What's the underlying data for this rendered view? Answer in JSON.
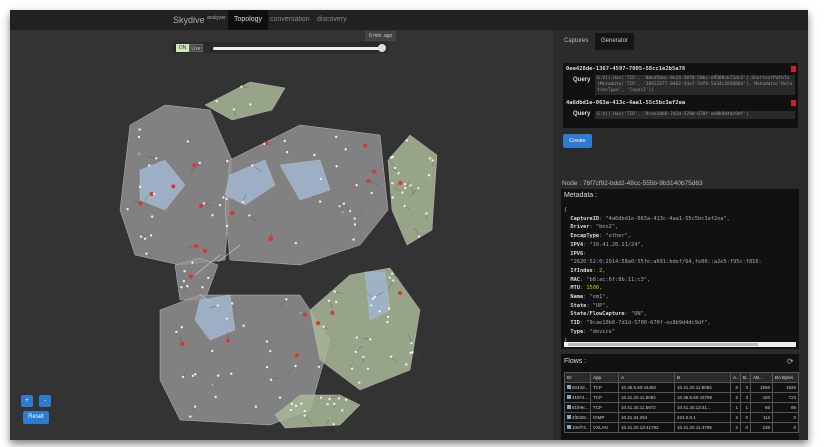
{
  "nav": {
    "brand": "Skydive",
    "brand_sup": "analyzer",
    "tabs": [
      "Topology",
      "conversation",
      "discovery"
    ],
    "active": "Topology"
  },
  "timeline": {
    "on": "ON",
    "live": "Live",
    "ago": "6 min. ago",
    "position": 1.0
  },
  "controls": {
    "zoom_in": "+",
    "zoom_out": "-",
    "reset": "Reset"
  },
  "right": {
    "tabs": [
      "Captures",
      "Generator"
    ],
    "captures": [
      {
        "id": "0ee428de-1367-4597-7005-58cc1e2b5a78",
        "query_label": "Query",
        "query": "G.V().Has('TID', '0dcd50dc-9e24-50f8-58bc-e9508cb71dc2').ShortestPathTo(Metadata('TID', '30922877-0462-54e7-5df0-5d34c2840864'), Metadata('RelationType', 'layer2'))"
      },
      {
        "id": "4a6dbd1e-063a-413c-4aa1-55c5bc3af2ea",
        "query_label": "Query",
        "query": "G.V().Has('TID', '9cae10b8-7d1d-5700-670f-ee8b9d4dc9df')"
      }
    ],
    "create_label": "Create",
    "node_label": "Node : 7bf7cf92-bdd2-48cc-555b-9b3140b75d63",
    "metadata_title": "Metadata :",
    "metadata": [
      [
        "CaptureID",
        "\"4a6dbd1e-063a-413c-4aa1-55c5bc3af2ea\","
      ],
      [
        "Driver",
        "\"bnx2\","
      ],
      [
        "EncapType",
        "\"ether\","
      ],
      [
        "IPV4",
        "\"10.41.20.11/24\","
      ],
      [
        "IPV6",
        ""
      ],
      [
        "",
        "\"2620:52:0:2914:58a0:55fe:a691:bdef/64,fe80::a2e5:f95c:f816:"
      ],
      [
        "IfIndex",
        "2,"
      ],
      [
        "MAC",
        "\"b8:ac:6f:8b:11:c3\","
      ],
      [
        "MTU",
        "1500,"
      ],
      [
        "Name",
        "\"em1\","
      ],
      [
        "State",
        "\"UP\","
      ],
      [
        "State/FlowCapture",
        "\"ON\","
      ],
      [
        "TID",
        "\"9cae10b8-7d1d-5700-670f-ee8b9d4dc9df\","
      ],
      [
        "Type",
        "\"device\""
      ]
    ],
    "flows_title": "Flows :",
    "flows_columns": [
      "ID",
      "App.",
      "A",
      "B",
      "A...",
      "B...",
      "AB...",
      "BA Bytes"
    ],
    "flows": [
      [
        "5043d...",
        "TCP",
        "10.36.5.50:44482",
        "10.41.20.11:8082",
        "6",
        "3",
        "1556",
        "1926"
      ],
      [
        "41974...",
        "TCP",
        "10.41.20.11:8082",
        "10.36.5.50:43798",
        "2",
        "3",
        "420",
        "723"
      ],
      [
        "81fe6c...",
        "TCP",
        "10.41.20.11:5672",
        "10.41.20.13:41...",
        "1",
        "1",
        "66",
        "66"
      ],
      [
        "4f6328...",
        "IGMP",
        "10.41.34.254",
        "224.0.0.1",
        "2",
        "0",
        "112",
        "0"
      ],
      [
        "10ef74...",
        "VXLAN",
        "10.41.20.13:41782",
        "10.41.20.11:4789",
        "2",
        "0",
        "238",
        "0"
      ]
    ]
  },
  "colors": {
    "hull_gray": "#8f8f8f",
    "hull_green": "#a9b896",
    "hull_blue": "#9fb4cc",
    "accent": "#2f7bd1",
    "node_red": "#d33",
    "node_green": "#7c7"
  }
}
